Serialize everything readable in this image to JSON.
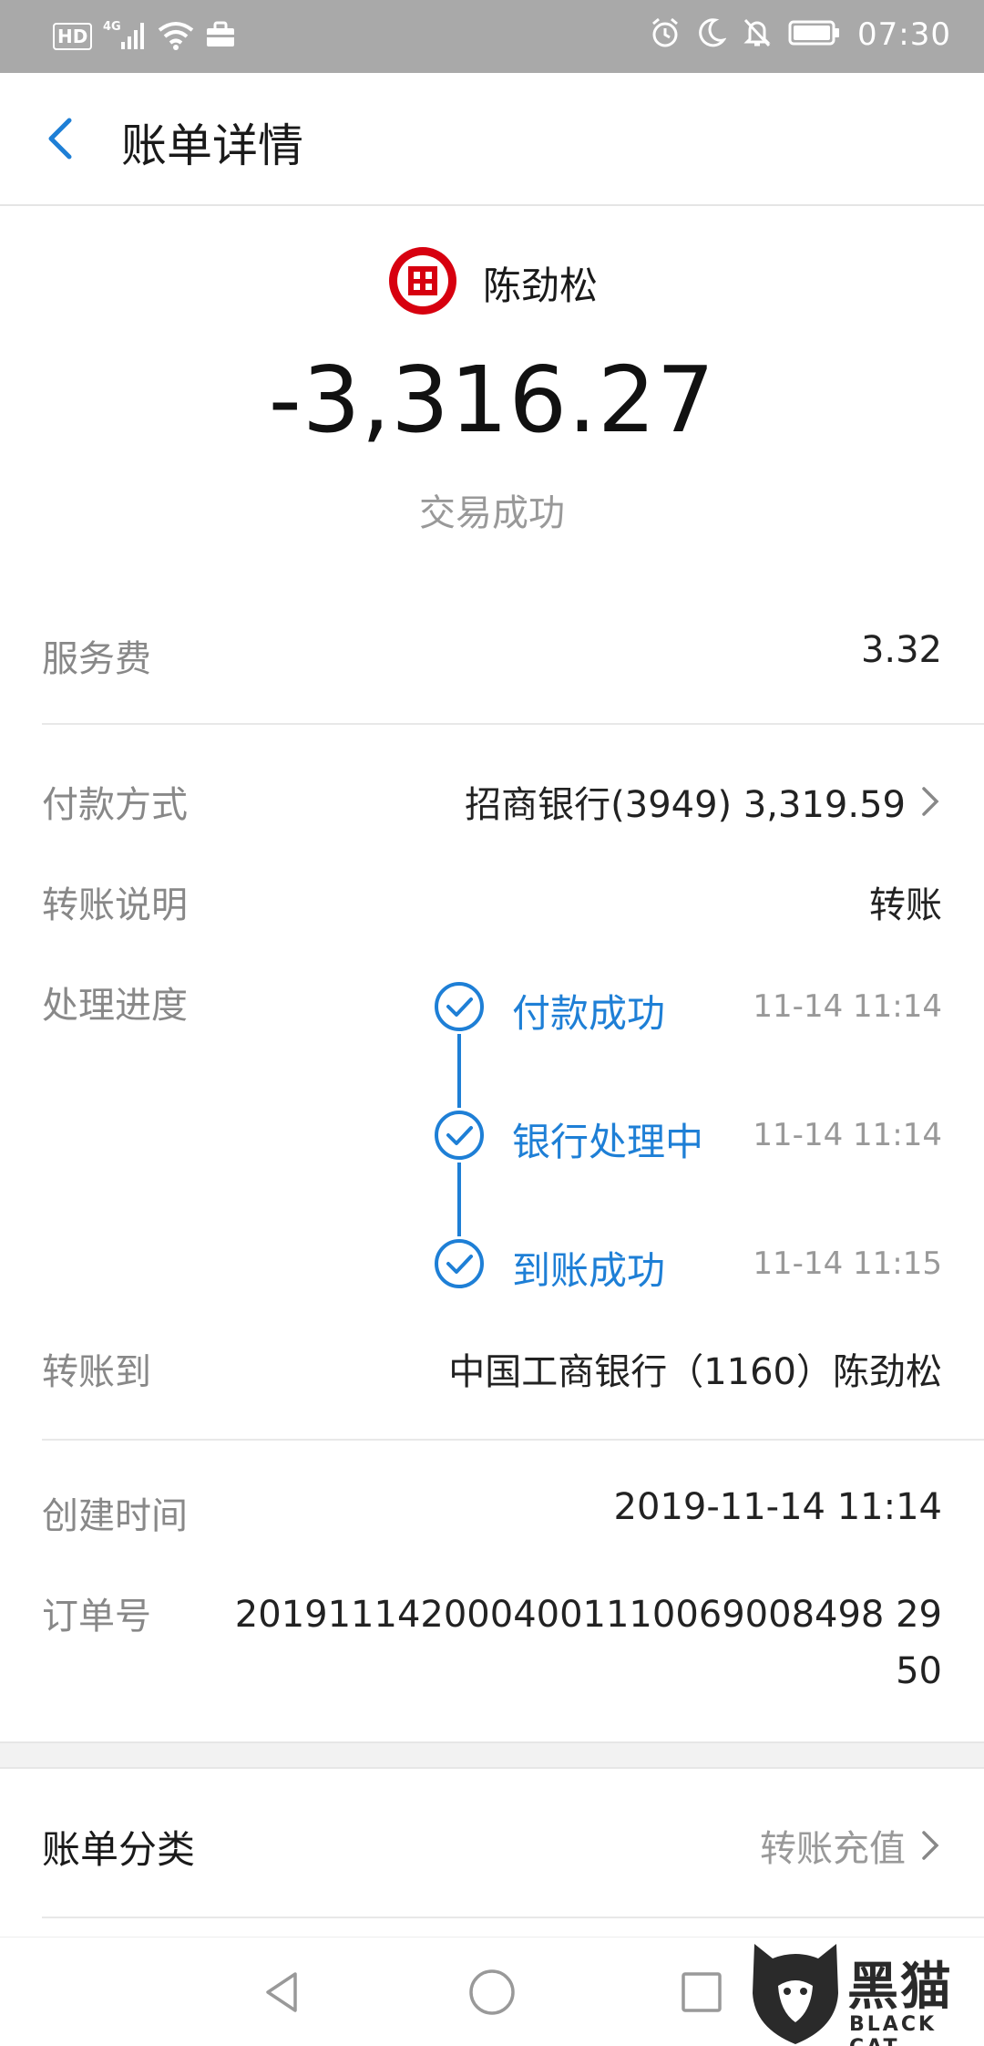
{
  "status_bar": {
    "left_icons": [
      "hd-icon",
      "signal-4g-icon",
      "wifi-icon",
      "briefcase-icon"
    ],
    "hd_label": "HD",
    "network_label": "4G",
    "right_icons": [
      "alarm-icon",
      "moon-icon",
      "mute-bell-icon",
      "battery-icon"
    ],
    "time": "07:30"
  },
  "header": {
    "title": "账单详情"
  },
  "summary": {
    "payee_name": "陈劲松",
    "payee_logo": "icbc-logo",
    "amount": "-3,316.27",
    "status": "交易成功"
  },
  "fee": {
    "label": "服务费",
    "value": "3.32"
  },
  "payment_method": {
    "label": "付款方式",
    "value": "招商银行(3949) 3,319.59"
  },
  "transfer_note": {
    "label": "转账说明",
    "value": "转账"
  },
  "progress": {
    "label": "处理进度",
    "steps": [
      {
        "label": "付款成功",
        "time": "11-14 11:14"
      },
      {
        "label": "银行处理中",
        "time": "11-14 11:14"
      },
      {
        "label": "到账成功",
        "time": "11-14 11:15"
      }
    ]
  },
  "transfer_to": {
    "label": "转账到",
    "value": "中国工商银行（1160）陈劲松"
  },
  "created_time": {
    "label": "创建时间",
    "value": "2019-11-14 11:14"
  },
  "order_no": {
    "label": "订单号",
    "value": "2019111420004001110069008498 2950"
  },
  "category": {
    "label": "账单分类",
    "value": "转账充值"
  },
  "watermark": {
    "cn": "黑猫",
    "en": "BLACK CAT"
  },
  "colors": {
    "accent": "#1e7fd6",
    "status_bar": "#a9a9a9",
    "icbc_red": "#d7000f"
  }
}
